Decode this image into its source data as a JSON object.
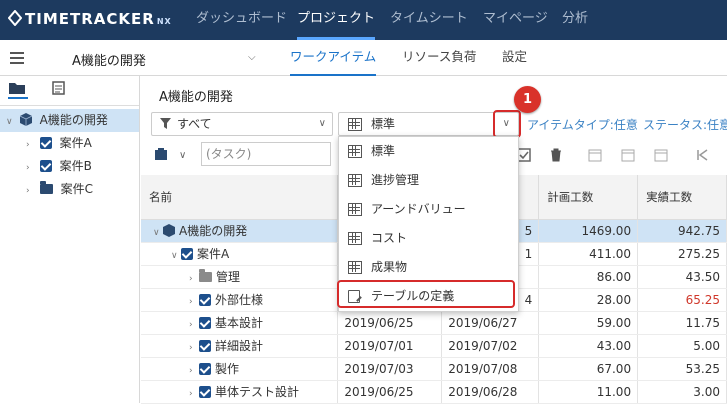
{
  "app": {
    "logo": "TIMETRACKER",
    "logo_suffix": "NX"
  },
  "nav": [
    "ダッシュボード",
    "プロジェクト",
    "タイムシート",
    "マイページ",
    "分析"
  ],
  "project": {
    "name": "A機能の開発"
  },
  "subtabs": [
    "ワークアイテム",
    "リソース負荷",
    "設定"
  ],
  "tree": [
    {
      "label": "A機能の開発",
      "level": 0
    },
    {
      "label": "案件A",
      "level": 1
    },
    {
      "label": "案件B",
      "level": 1
    },
    {
      "label": "案件C",
      "level": 1
    }
  ],
  "main": {
    "title": "A機能の開発",
    "filter_all": "すべて",
    "view_selected": "標準",
    "item_type_filter": "アイテムタイプ:任意",
    "status_filter": "ステータス:任意",
    "search_placeholder": "(タスク)"
  },
  "badge": "1",
  "dropdown": [
    "標準",
    "進捗管理",
    "アーンドバリュー",
    "コスト",
    "成果物",
    "テーブルの定義"
  ],
  "table": {
    "headers": [
      "名前",
      "",
      "",
      "計画工数",
      "実績工数"
    ],
    "rows": [
      {
        "name": "A機能の開発",
        "start": "",
        "end": "5",
        "plan": "1469.00",
        "actual": "942.75"
      },
      {
        "name": "案件A",
        "start": "",
        "end": "1",
        "plan": "411.00",
        "actual": "275.25"
      },
      {
        "name": "管理",
        "start": "",
        "end": "",
        "plan": "86.00",
        "actual": "43.50"
      },
      {
        "name": "外部仕様",
        "start": "",
        "end": "4",
        "plan": "28.00",
        "actual": "65.25"
      },
      {
        "name": "基本設計",
        "start": "2019/06/25",
        "end": "2019/06/27",
        "plan": "59.00",
        "actual": "11.75"
      },
      {
        "name": "詳細設計",
        "start": "2019/07/01",
        "end": "2019/07/02",
        "plan": "43.00",
        "actual": "5.00"
      },
      {
        "name": "製作",
        "start": "2019/07/03",
        "end": "2019/07/08",
        "plan": "67.00",
        "actual": "53.25"
      },
      {
        "name": "単体テスト設計",
        "start": "2019/06/25",
        "end": "2019/06/28",
        "plan": "11.00",
        "actual": "3.00"
      }
    ]
  },
  "colors": {
    "topbar": "#1d3a5f",
    "accent": "#1a73c9",
    "highlight": "#d62b2b",
    "over_budget": "#d0382b"
  }
}
